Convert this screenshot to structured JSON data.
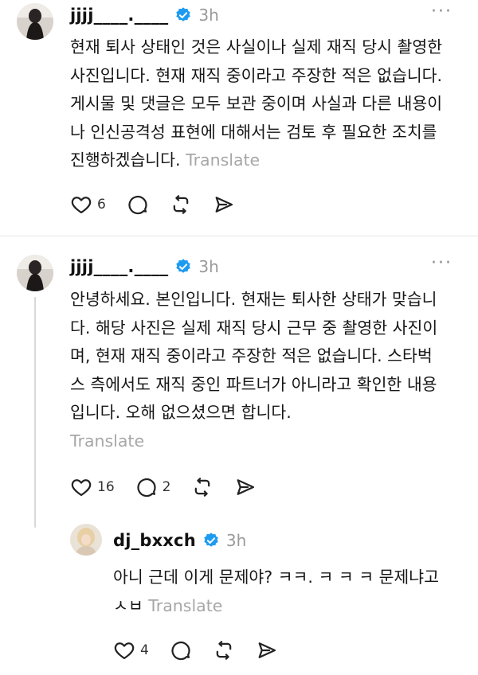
{
  "posts": [
    {
      "username": "jjjj____.____",
      "time": "3h",
      "more": "···",
      "text": "현재 퇴사 상태인 것은 사실이나 실제 재직 당시 촬영한 사진입니다. 현재 재직 중이라고 주장한 적은 없습니다. 게시물 및 댓글은 모두 보관 중이며 사실과 다른 내용이나 인신공격성 표현에 대해서는 검토 후 필요한 조치를 진행하겠습니다.",
      "translate": "Translate",
      "likes": "6",
      "comments": ""
    },
    {
      "username": "jjjj____.____",
      "time": "3h",
      "more": "···",
      "text": "안녕하세요. 본인입니다. 현재는 퇴사한 상태가 맞습니다. 해당 사진은 실제 재직 당시 근무 중 촬영한 사진이며, 현재 재직 중이라고 주장한 적은 없습니다. 스타벅스 측에서도 재직 중인 파트너가 아니라고 확인한 내용입니다. 오해 없으셨으면 합니다.",
      "translate": "Translate",
      "likes": "16",
      "comments": "2"
    },
    {
      "username": "dj_bxxch",
      "time": "3h",
      "text": "아니 근데 이게 문제야? ㅋㅋ. ㅋ ㅋ ㅋ 문제냐고 ㅅㅂ",
      "translate": "Translate",
      "likes": "4",
      "comments": ""
    }
  ],
  "icons": {
    "like": "heart-icon",
    "comment": "comment-icon",
    "repost": "repost-icon",
    "share": "send-icon",
    "verified": "verified-badge-icon"
  },
  "colors": {
    "verified": "#1d9bf0",
    "secondary_text": "#9a9a9a",
    "divider": "#e6e6e6"
  }
}
